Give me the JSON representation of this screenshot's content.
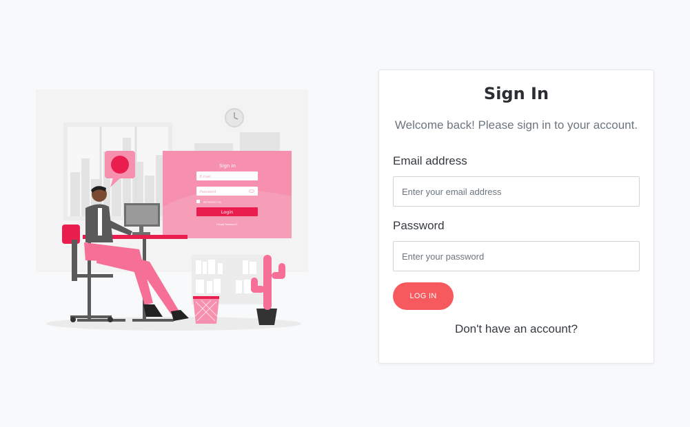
{
  "login": {
    "title": "Sign In",
    "subtitle": "Welcome back! Please sign in to your account.",
    "email_label": "Email address",
    "email_placeholder": "Enter your email address",
    "email_value": "",
    "password_label": "Password",
    "password_placeholder": "Enter your password",
    "password_value": "",
    "submit_label": "LOG IN",
    "signup_text": "Don't have an account?"
  },
  "illustration": {
    "mock_title": "Sign in",
    "mock_email_placeholder": "E-mail",
    "mock_password_placeholder": "Password",
    "mock_remember": "Remember me",
    "mock_button": "Login",
    "mock_forgot": "Forgot Password?"
  },
  "colors": {
    "accent": "#f65a5f",
    "illustration_pink": "#f56f97",
    "illustration_red": "#e91e4f",
    "background": "#f8f9fa"
  }
}
